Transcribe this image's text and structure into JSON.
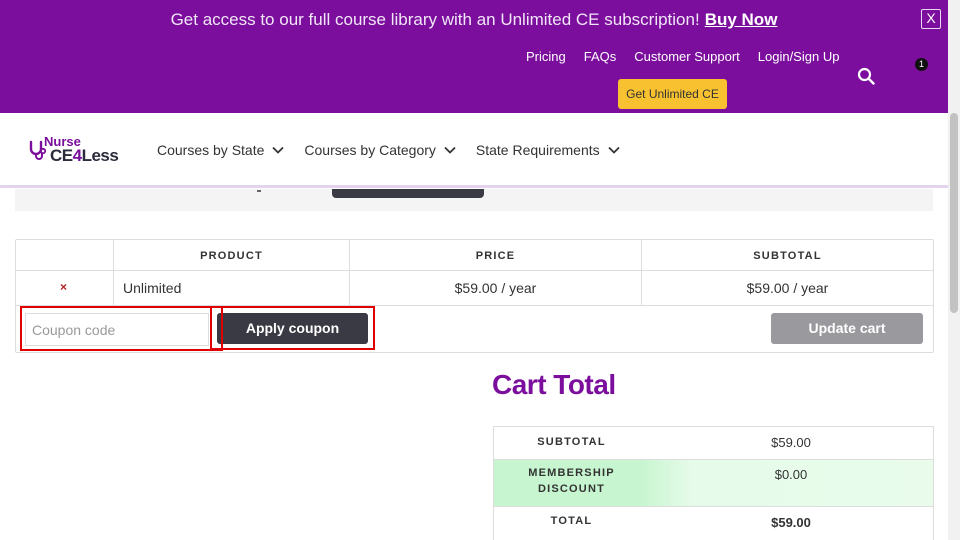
{
  "banner": {
    "promo_text": "Get access to our full course library with an Unlimited CE subscription!",
    "buy_now": "Buy Now",
    "close": "X",
    "links": [
      "Pricing",
      "FAQs",
      "Customer Support",
      "Login/Sign Up"
    ],
    "cta": "Get Unlimited CE",
    "cart_count": "1",
    "bg_color": "#7b0e9c",
    "cta_color": "#f8c12f"
  },
  "logo": {
    "line1": "Nurse",
    "line2a": "CE",
    "line2b": "4",
    "line2c": "Less"
  },
  "nav": {
    "items": [
      {
        "label": "Courses by State"
      },
      {
        "label": "Courses by Category"
      },
      {
        "label": "State Requirements"
      }
    ]
  },
  "cart": {
    "headers": [
      "",
      "PRODUCT",
      "PRICE",
      "SUBTOTAL"
    ],
    "row": {
      "remove": "×",
      "product": "Unlimited",
      "price": "$59.00 / year",
      "subtotal": "$59.00 / year"
    },
    "coupon_placeholder": "Coupon code",
    "apply_label": "Apply coupon",
    "update_label": "Update cart"
  },
  "totals": {
    "title": "Cart Total",
    "rows": [
      {
        "label": "SUBTOTAL",
        "value": "$59.00"
      },
      {
        "label_line1": "MEMBERSHIP",
        "label_line2": "DISCOUNT",
        "value": "$0.00"
      },
      {
        "label": "TOTAL",
        "value": "$59.00"
      }
    ],
    "title_color": "#7b0e9c",
    "discount_color": "#c6f5cf"
  }
}
